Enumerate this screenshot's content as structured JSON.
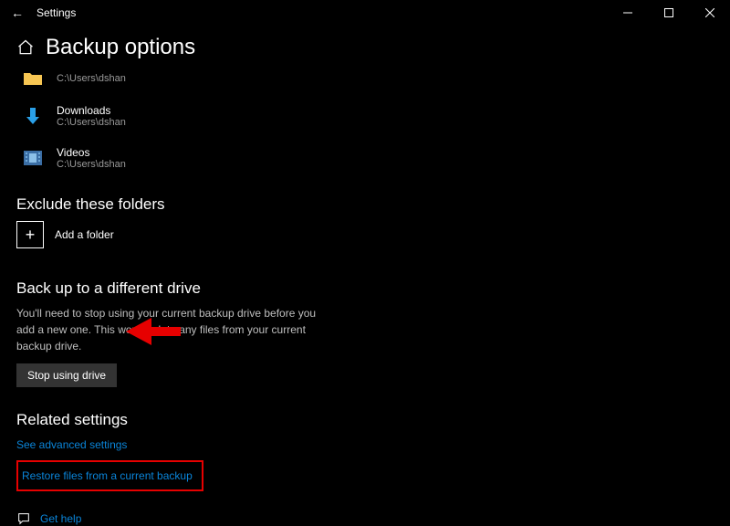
{
  "app": {
    "title": "Settings"
  },
  "header": {
    "page_title": "Backup options"
  },
  "folders": [
    {
      "name": "",
      "path": "C:\\Users\\dshan",
      "icon": "folder"
    },
    {
      "name": "Downloads",
      "path": "C:\\Users\\dshan",
      "icon": "downloads"
    },
    {
      "name": "Videos",
      "path": "C:\\Users\\dshan",
      "icon": "videos"
    }
  ],
  "exclude": {
    "title": "Exclude these folders",
    "add_label": "Add a folder"
  },
  "drive": {
    "title": "Back up to a different drive",
    "desc": "You'll need to stop using your current backup drive before you add a new one. This won't delete any files from your current backup drive.",
    "button": "Stop using drive"
  },
  "related": {
    "title": "Related settings",
    "advanced_link": "See advanced settings",
    "restore_link": "Restore files from a current backup"
  },
  "help": {
    "label": "Get help"
  }
}
